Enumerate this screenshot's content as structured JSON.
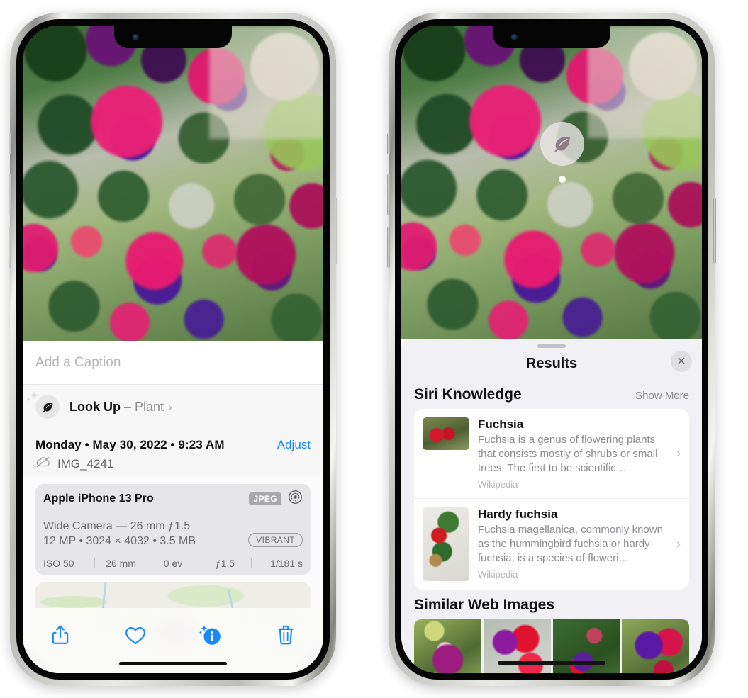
{
  "left_phone": {
    "photo": {
      "alt": "fuchsia-flowers-photo"
    },
    "caption": {
      "placeholder": "Add a Caption",
      "value": ""
    },
    "look_up": {
      "icon": "leaf-icon",
      "label": "Look Up",
      "dash": "–",
      "subject": "Plant",
      "chevron": "›"
    },
    "meta": {
      "date_line": "Monday • May 30, 2022 • 9:23 AM",
      "adjust_label": "Adjust",
      "cloud_icon": "cloud-slash-icon",
      "file_name": "IMG_4241"
    },
    "camera_card": {
      "model": "Apple iPhone 13 Pro",
      "format_badge": "JPEG",
      "aperture_icon": "aperture-icon",
      "lens": "Wide Camera — 26 mm ƒ1.5",
      "specs": "12 MP • 3024 × 4032 • 3.5 MB",
      "style_pill": "VIBRANT",
      "exif": [
        "ISO 50",
        "26 mm",
        "0 ev",
        "ƒ1.5",
        "1/181 s"
      ]
    },
    "toolbar": [
      {
        "name": "share-button",
        "icon": "share-icon"
      },
      {
        "name": "favorite-button",
        "icon": "heart-icon"
      },
      {
        "name": "info-button",
        "icon": "info-sparkle-icon"
      },
      {
        "name": "delete-button",
        "icon": "trash-icon"
      }
    ]
  },
  "right_phone": {
    "badge": {
      "icon": "leaf-icon"
    },
    "sheet": {
      "title": "Results",
      "close_icon": "close-icon",
      "siri_knowledge": {
        "title": "Siri Knowledge",
        "action": "Show More",
        "items": [
          {
            "title": "Fuchsia",
            "description": "Fuchsia is a genus of flowering plants that consists mostly of shrubs or small trees. The first to be scientific…",
            "source": "Wikipedia",
            "chevron": "›"
          },
          {
            "title": "Hardy fuchsia",
            "description": "Fuchsia magellanica, commonly known as the hummingbird fuchsia or hardy fuchsia, is a species of floweri…",
            "source": "Wikipedia",
            "chevron": "›"
          }
        ]
      },
      "similar_web_images": {
        "title": "Similar Web Images",
        "thumbnails": [
          "web-image-1",
          "web-image-2",
          "web-image-3",
          "web-image-4"
        ]
      }
    }
  },
  "colors": {
    "accent_blue": "#1b88f5",
    "sheet_bg": "#f1f1f5",
    "card_bg": "#ffffff",
    "muted_text": "#8a8a8f"
  }
}
